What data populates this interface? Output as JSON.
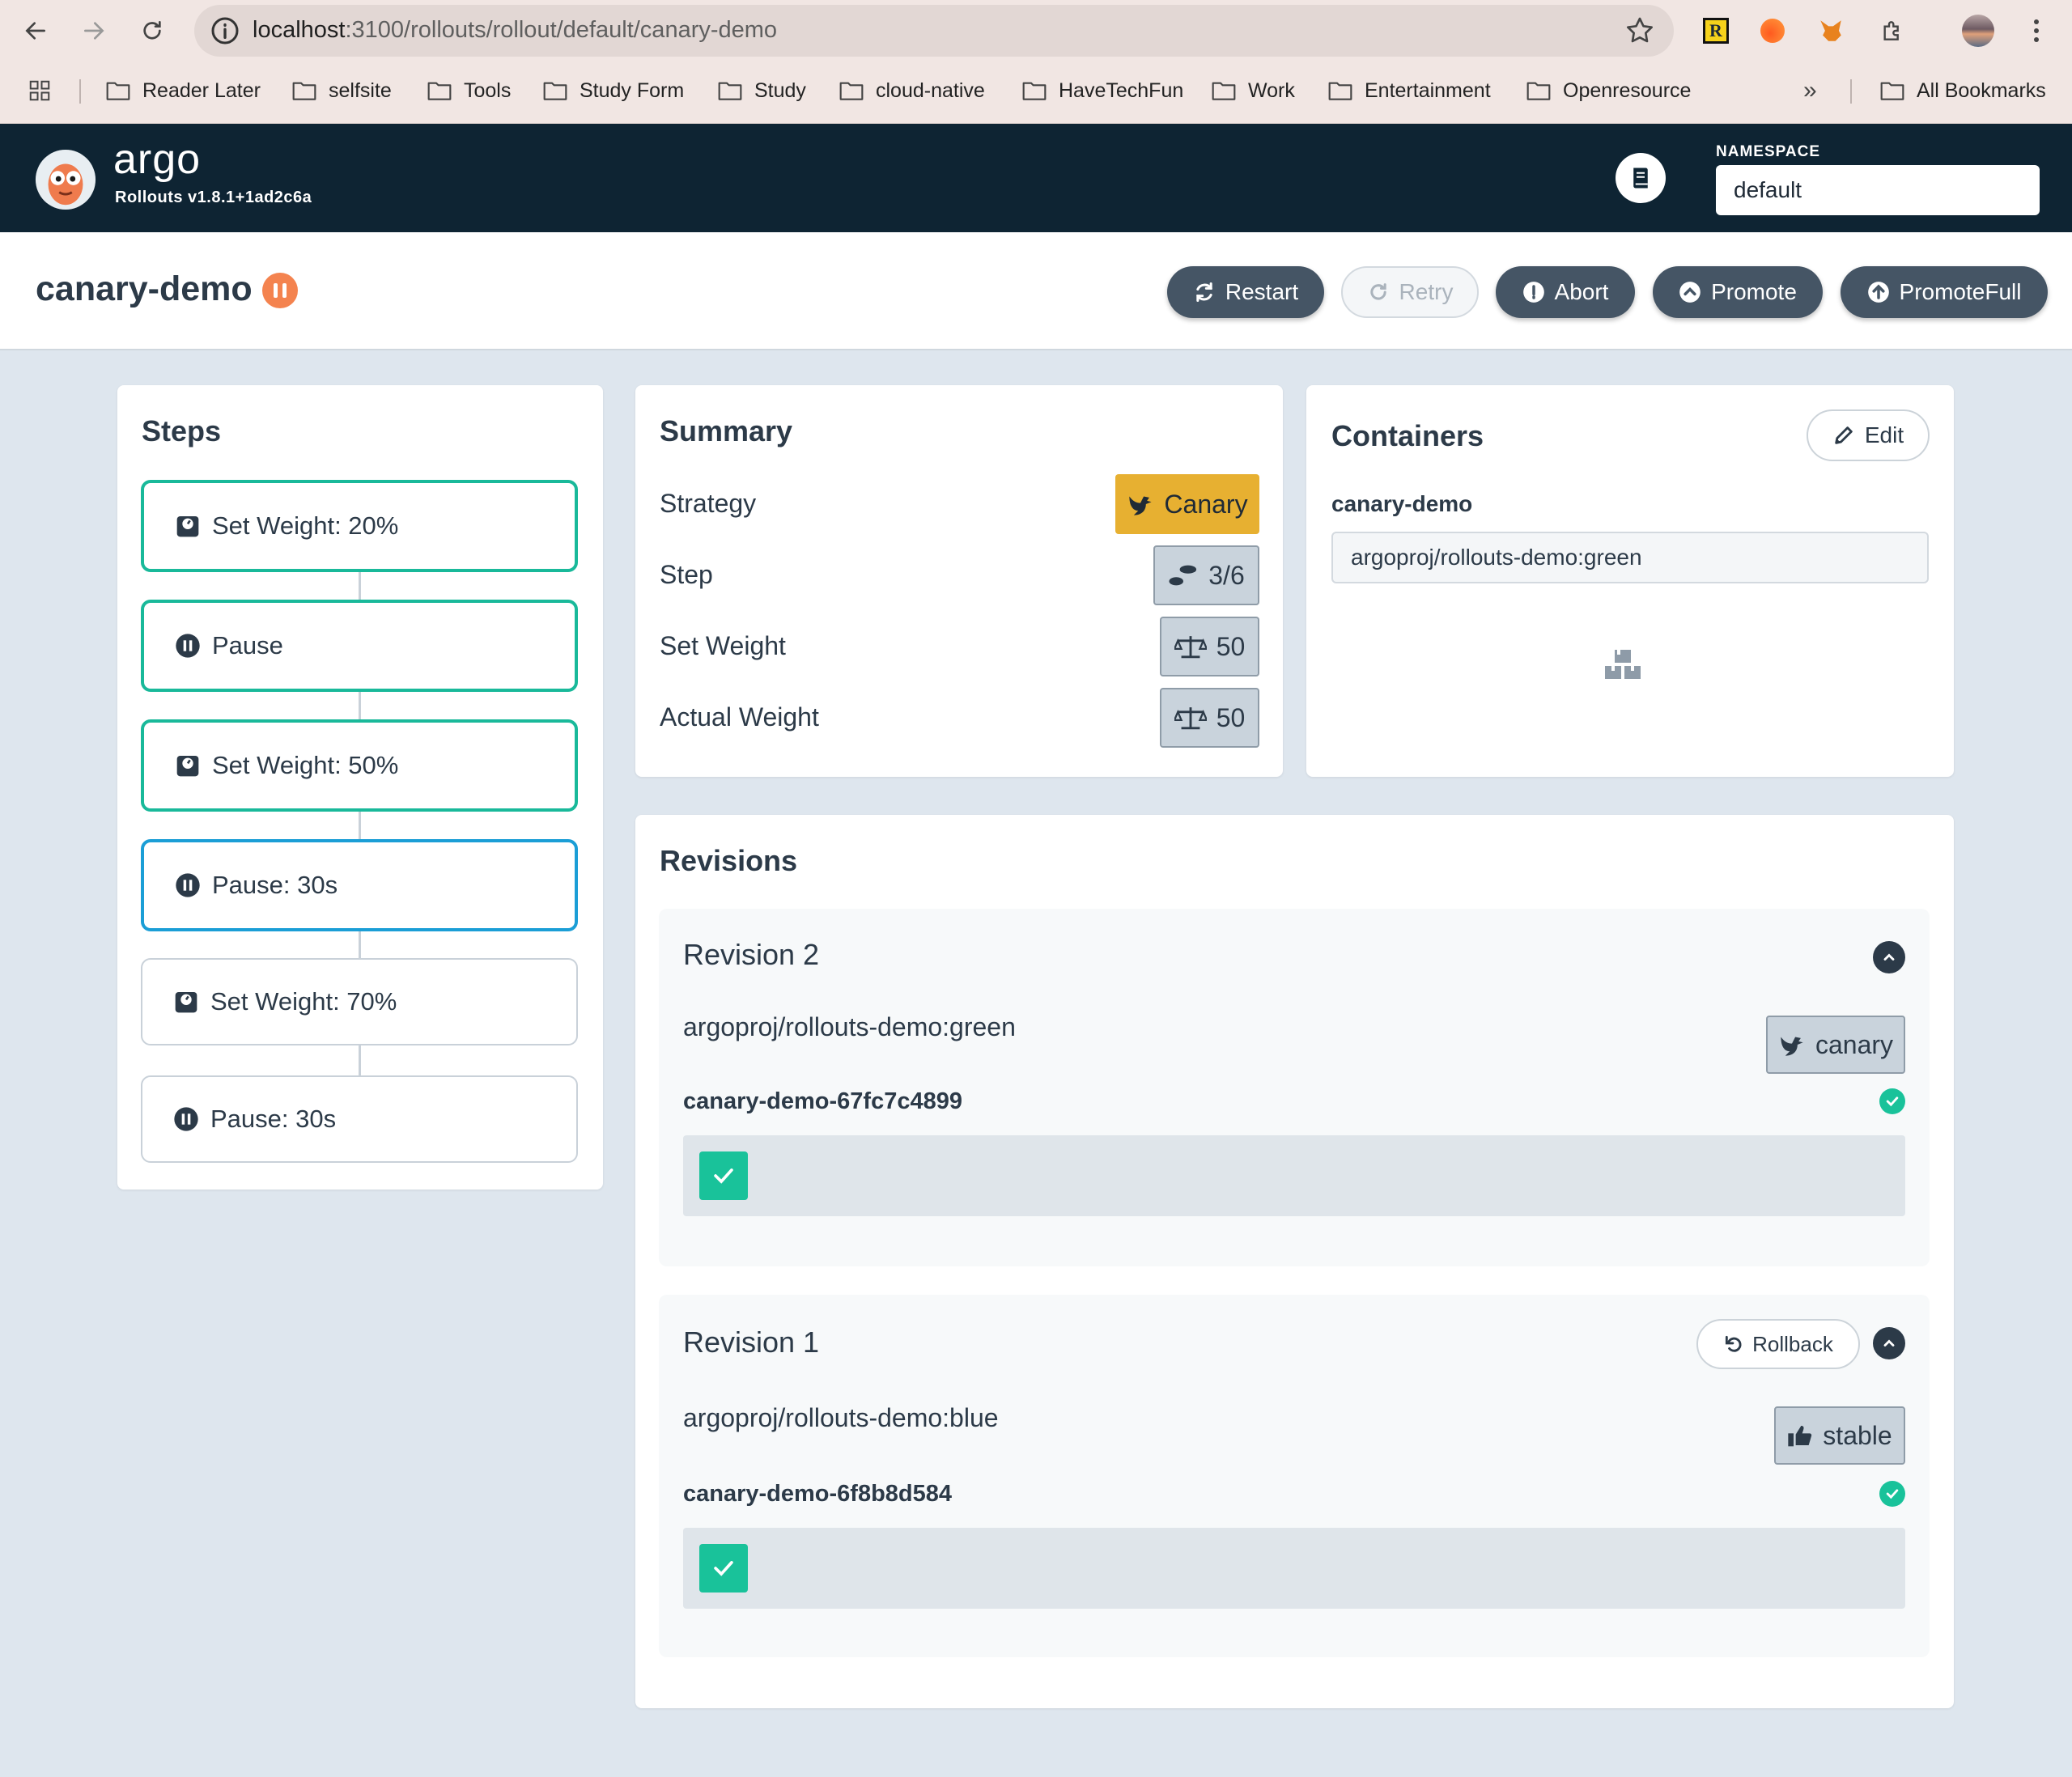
{
  "browser": {
    "url_host": "localhost",
    "url_path": ":3100/rollouts/rollout/default/canary-demo",
    "bookmarks": [
      "Reader Later",
      "selfsite",
      "Tools",
      "Study Form",
      "Study",
      "cloud-native",
      "HaveTechFun",
      "Work",
      "Entertainment",
      "Openresource"
    ],
    "all_bookmarks": "All Bookmarks",
    "overflow": "»"
  },
  "header": {
    "brand": "argo",
    "version": "Rollouts v1.8.1+1ad2c6a",
    "namespace_label": "NAMESPACE",
    "namespace_value": "default"
  },
  "rollout": {
    "name": "canary-demo",
    "status": "paused",
    "actions": {
      "restart": "Restart",
      "retry": "Retry",
      "abort": "Abort",
      "promote": "Promote",
      "promote_full": "PromoteFull"
    }
  },
  "steps": {
    "title": "Steps",
    "items": [
      {
        "label": "Set Weight: 20%",
        "icon": "weight-icon",
        "state": "complete"
      },
      {
        "label": "Pause",
        "icon": "pause-icon",
        "state": "complete"
      },
      {
        "label": "Set Weight: 50%",
        "icon": "weight-icon",
        "state": "complete"
      },
      {
        "label": "Pause: 30s",
        "icon": "pause-icon",
        "state": "current"
      },
      {
        "label": "Set Weight: 70%",
        "icon": "weight-icon",
        "state": "pending"
      },
      {
        "label": "Pause: 30s",
        "icon": "pause-icon",
        "state": "pending"
      }
    ]
  },
  "summary": {
    "title": "Summary",
    "strategy_label": "Strategy",
    "strategy_value": "Canary",
    "step_label": "Step",
    "step_value": "3/6",
    "set_weight_label": "Set Weight",
    "set_weight_value": "50",
    "actual_weight_label": "Actual Weight",
    "actual_weight_value": "50"
  },
  "containers": {
    "title": "Containers",
    "edit_label": "Edit",
    "name": "canary-demo",
    "image": "argoproj/rollouts-demo:green"
  },
  "revisions": {
    "title": "Revisions",
    "items": [
      {
        "title": "Revision 2",
        "image": "argoproj/rollouts-demo:green",
        "tag": "canary",
        "replicaset": "canary-demo-67fc7c4899"
      },
      {
        "title": "Revision 1",
        "image": "argoproj/rollouts-demo:blue",
        "tag": "stable",
        "replicaset": "canary-demo-6f8b8d584",
        "rollback_label": "Rollback"
      }
    ]
  },
  "colors": {
    "header_bg": "#0e2433",
    "step_complete": "#19b99a",
    "step_current": "#1b9ed6",
    "canary_badge": "#e7b031",
    "paused_badge": "#f4834f",
    "healthy": "#19c29a"
  }
}
